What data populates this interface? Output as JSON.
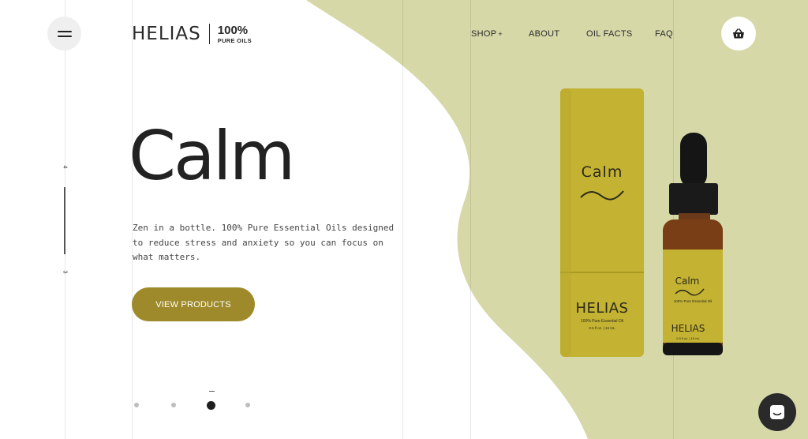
{
  "brand": {
    "name": "HELIAS",
    "badge_pct": "100%",
    "badge_text": "PURE OILS"
  },
  "nav": {
    "items": [
      {
        "label": "SHOP",
        "suffix": "+"
      },
      {
        "label": "ABOUT"
      },
      {
        "label": "OIL FACTS"
      },
      {
        "label": "FAQ"
      }
    ]
  },
  "icons": {
    "menu": "hamburger-icon",
    "cart": "basket-icon",
    "chat": "chat-icon"
  },
  "slider": {
    "next_number": "4",
    "current_number": "3",
    "dots_count": 4,
    "active_dot": 3
  },
  "hero": {
    "title": "Calm",
    "description": "Zen in a bottle. 100% Pure Essential Oils designed to reduce stress and anxiety so you can focus on what matters.",
    "cta_label": "VIEW PRODUCTS"
  },
  "product": {
    "tube_label": "Calm",
    "tube_brand": "HELIAS",
    "tube_sub": "100% Pure Essential Oil",
    "tube_size": "0.5 fl oz.  |  15 mL",
    "bottle_label": "Calm",
    "bottle_sub": "100% Pure Essential Oil",
    "bottle_brand": "HELIAS",
    "bottle_size": "0.5 fl oz.  |  15 mL"
  },
  "colors": {
    "accent_bg": "#d6d8a8",
    "button": "#9e8a2a",
    "tube": "#c4b232",
    "dark": "#222222"
  }
}
